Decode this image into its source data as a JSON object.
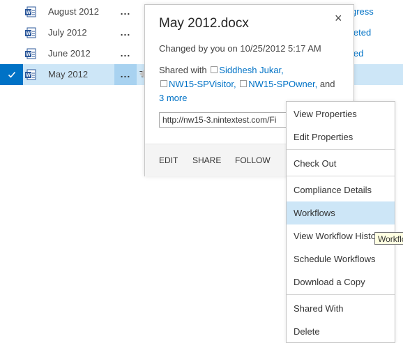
{
  "rows": [
    {
      "name": "August 2012",
      "status": "gress",
      "selected": false
    },
    {
      "name": "July 2012",
      "status": "leted",
      "selected": false
    },
    {
      "name": "June 2012",
      "status": "led",
      "selected": false
    },
    {
      "name": "May 2012",
      "status": "",
      "selected": true
    }
  ],
  "row_ellipsis": "...",
  "row_tchar": "T",
  "callout": {
    "title": "May 2012.docx",
    "close": "×",
    "changed": "Changed by you on 10/25/2012 5:17 AM",
    "shared_prefix": "Shared with",
    "shared_users": [
      "Siddhesh Jukar,",
      "NW15-SPVisitor,",
      "NW15-SPOwner,"
    ],
    "shared_and": "and",
    "more_link": "3 more",
    "url": "http://nw15-3.nintextest.com/Fi",
    "actions": {
      "edit": "EDIT",
      "share": "SHARE",
      "follow": "FOLLOW"
    }
  },
  "menu": {
    "items": [
      "View Properties",
      "Edit Properties",
      "Check Out",
      "Compliance Details",
      "Workflows",
      "View Workflow Histo",
      "Schedule Workflows",
      "Download a Copy",
      "Shared With",
      "Delete"
    ],
    "highlighted": "Workflows"
  },
  "tooltip": "Workflo",
  "colors": {
    "accent": "#0072c6",
    "selection": "#cde6f7"
  }
}
